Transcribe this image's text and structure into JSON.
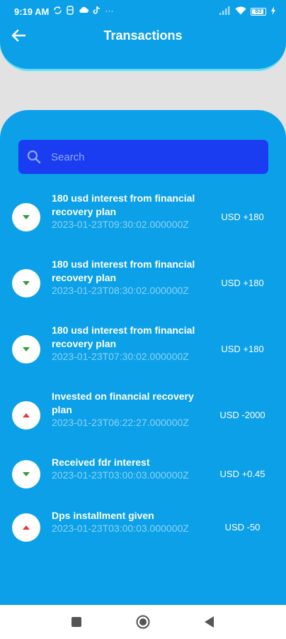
{
  "status_bar": {
    "time": "9:19 AM",
    "dots": "···",
    "battery": "83"
  },
  "header": {
    "title": "Transactions"
  },
  "search": {
    "placeholder": "Search"
  },
  "transactions": [
    {
      "title": "180 usd interest from financial recovery plan",
      "date": "2023-01-23T09:30:02.000000Z",
      "amount": "USD +180",
      "direction": "in"
    },
    {
      "title": "180 usd interest from financial recovery plan",
      "date": "2023-01-23T08:30:02.000000Z",
      "amount": "USD +180",
      "direction": "in"
    },
    {
      "title": "180 usd interest from financial recovery plan",
      "date": "2023-01-23T07:30:02.000000Z",
      "amount": "USD +180",
      "direction": "in"
    },
    {
      "title": "Invested on financial recovery plan",
      "date": "2023-01-23T06:22:27.000000Z",
      "amount": "USD -2000",
      "direction": "out"
    },
    {
      "title": "Received fdr interest",
      "date": "2023-01-23T03:00:03.000000Z",
      "amount": "USD +0.45",
      "direction": "in"
    },
    {
      "title": "Dps installment given",
      "date": "2023-01-23T03:00:03.000000Z",
      "amount": "USD -50",
      "direction": "out"
    }
  ],
  "colors": {
    "accent": "#0ba0e8",
    "search_bg": "#1b3df2",
    "incoming": "#2e9e3a",
    "outgoing": "#e53935"
  }
}
